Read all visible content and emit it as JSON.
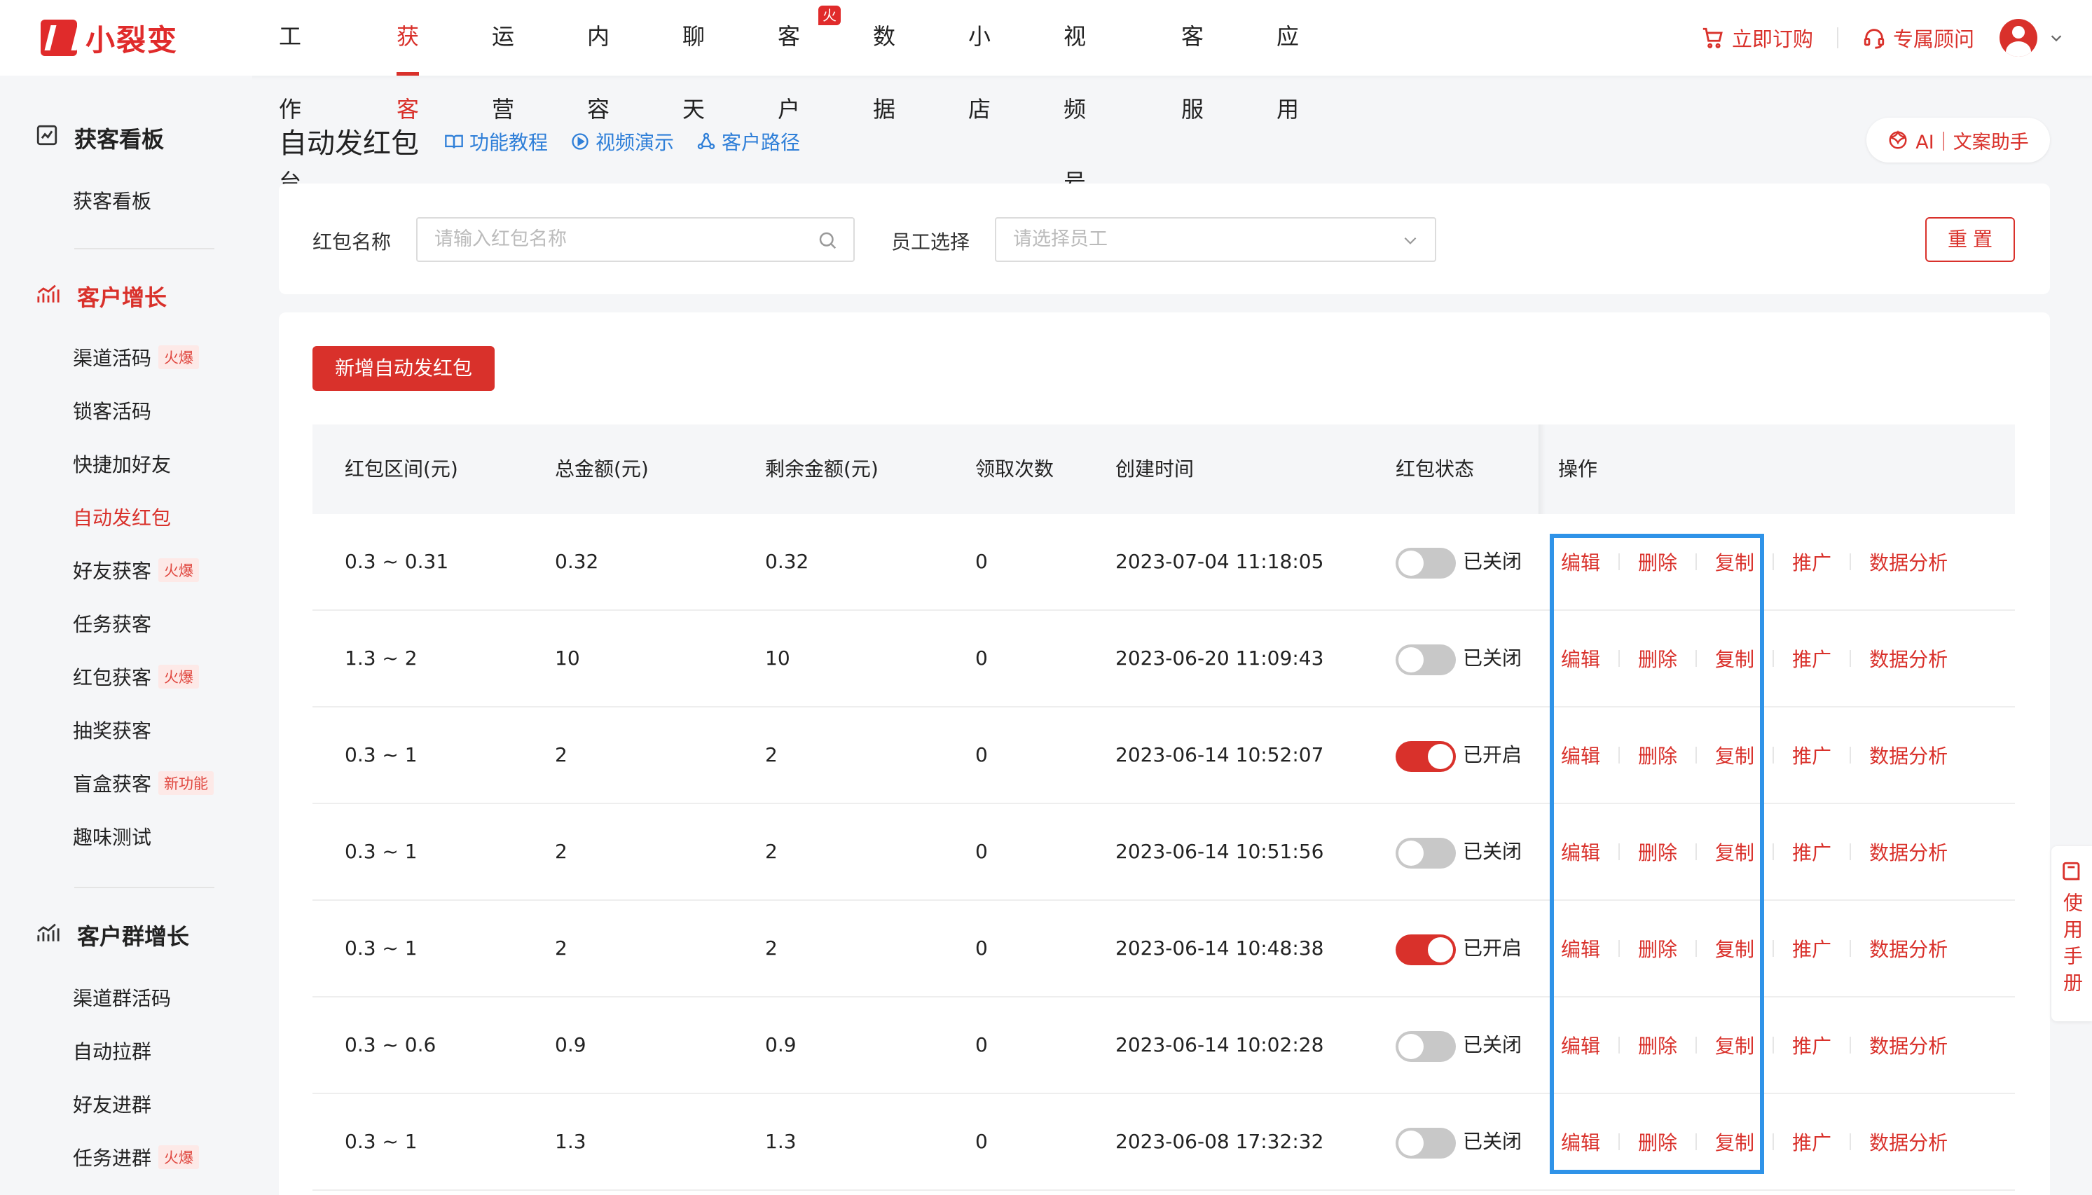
{
  "brand": {
    "name": "小裂变",
    "accent": "#d9312b"
  },
  "topnav": {
    "items": [
      {
        "label": "工作台",
        "active": false
      },
      {
        "label": "获客",
        "active": true
      },
      {
        "label": "运营",
        "active": false
      },
      {
        "label": "内容",
        "active": false
      },
      {
        "label": "聊天",
        "active": false
      },
      {
        "label": "客户",
        "active": false,
        "badge": "火爆"
      },
      {
        "label": "数据",
        "active": false
      },
      {
        "label": "小店",
        "active": false
      },
      {
        "label": "视频号",
        "active": false
      },
      {
        "label": "客服",
        "active": false
      },
      {
        "label": "应用",
        "active": false
      }
    ],
    "order_label": "立即订购",
    "advisor_label": "专属顾问"
  },
  "sidebar": {
    "groups": [
      {
        "title": "获客看板",
        "icon": "chart-board-icon",
        "items": [
          {
            "label": "获客看板"
          }
        ]
      },
      {
        "title": "客户增长",
        "icon": "growth-chart-icon",
        "highlight": true,
        "items": [
          {
            "label": "渠道活码",
            "tag": "火爆"
          },
          {
            "label": "锁客活码"
          },
          {
            "label": "快捷加好友"
          },
          {
            "label": "自动发红包",
            "active": true
          },
          {
            "label": "好友获客",
            "tag": "火爆"
          },
          {
            "label": "任务获客"
          },
          {
            "label": "红包获客",
            "tag": "火爆"
          },
          {
            "label": "抽奖获客"
          },
          {
            "label": "盲盒获客",
            "tag": "新功能"
          },
          {
            "label": "趣味测试"
          }
        ]
      },
      {
        "title": "客户群增长",
        "icon": "group-growth-icon",
        "items": [
          {
            "label": "渠道群活码"
          },
          {
            "label": "自动拉群"
          },
          {
            "label": "好友进群"
          },
          {
            "label": "任务进群",
            "tag": "火爆"
          }
        ]
      }
    ]
  },
  "page": {
    "title": "自动发红包",
    "links": [
      "功能教程",
      "视频演示",
      "客户路径"
    ],
    "ai_label": "AI｜文案助手"
  },
  "filters": {
    "name_label": "红包名称",
    "name_placeholder": "请输入红包名称",
    "staff_label": "员工选择",
    "staff_placeholder": "请选择员工",
    "reset_label": "重置"
  },
  "table": {
    "add_label": "新增自动发红包",
    "columns": [
      "红包区间(元)",
      "总金额(元)",
      "剩余金额(元)",
      "领取次数",
      "创建时间",
      "红包状态",
      "操作"
    ],
    "actions": [
      "编辑",
      "删除",
      "复制",
      "推广",
      "数据分析"
    ],
    "on_label": "已开启",
    "off_label": "已关闭",
    "rows": [
      {
        "range": "0.3 ~ 0.31",
        "total": "0.32",
        "remain": "0.32",
        "count": "0",
        "created": "2023-07-04 11:18:05",
        "on": false
      },
      {
        "range": "1.3 ~ 2",
        "total": "10",
        "remain": "10",
        "count": "0",
        "created": "2023-06-20 11:09:43",
        "on": false
      },
      {
        "range": "0.3 ~ 1",
        "total": "2",
        "remain": "2",
        "count": "0",
        "created": "2023-06-14 10:52:07",
        "on": true
      },
      {
        "range": "0.3 ~ 1",
        "total": "2",
        "remain": "2",
        "count": "0",
        "created": "2023-06-14 10:51:56",
        "on": false
      },
      {
        "range": "0.3 ~ 1",
        "total": "2",
        "remain": "2",
        "count": "0",
        "created": "2023-06-14 10:48:38",
        "on": true
      },
      {
        "range": "0.3 ~ 0.6",
        "total": "0.9",
        "remain": "0.9",
        "count": "0",
        "created": "2023-06-14 10:02:28",
        "on": false
      },
      {
        "range": "0.3 ~ 1",
        "total": "1.3",
        "remain": "1.3",
        "count": "0",
        "created": "2023-06-08 17:32:32",
        "on": false
      }
    ]
  },
  "manual": {
    "label": "使用手册"
  }
}
